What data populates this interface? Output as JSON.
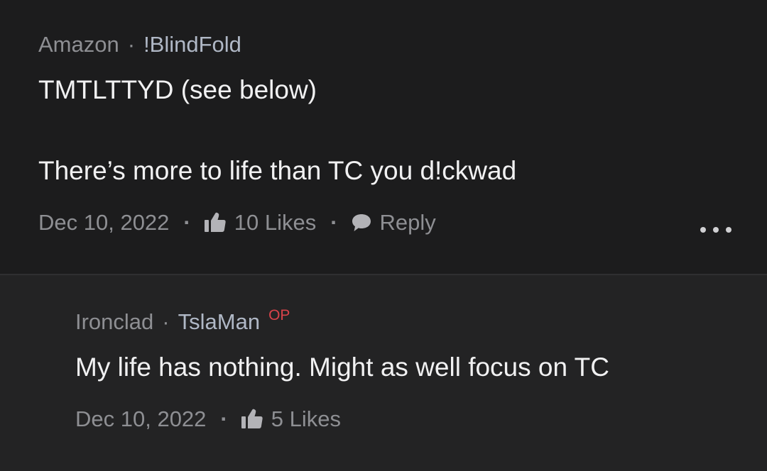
{
  "top_comment": {
    "company": "Amazon",
    "separator": "·",
    "username": "!BlindFold",
    "line1": "TMTLTTYD (see below)",
    "line2": "There’s more to life than TC you d!ckwad",
    "date": "Dec 10, 2022",
    "dot": "·",
    "likes": "10 Likes",
    "reply_label": "Reply"
  },
  "reply_comment": {
    "company": "Ironclad",
    "separator": "·",
    "username": "TslaMan",
    "badge": "OP",
    "text": "My life has nothing. Might as well focus on TC",
    "date": "Dec 10, 2022",
    "dot": "·",
    "likes": "5 Likes"
  },
  "icons": {
    "like": "thumbs-up-icon",
    "reply": "speech-bubble-icon",
    "more": "more-options-icon"
  },
  "colors": {
    "background": "#1c1c1d",
    "reply_background": "#232324",
    "muted_text": "#8e8f93",
    "username": "#b0b8c6",
    "body_text": "#f1f1f2",
    "op_badge": "#d8434a"
  }
}
